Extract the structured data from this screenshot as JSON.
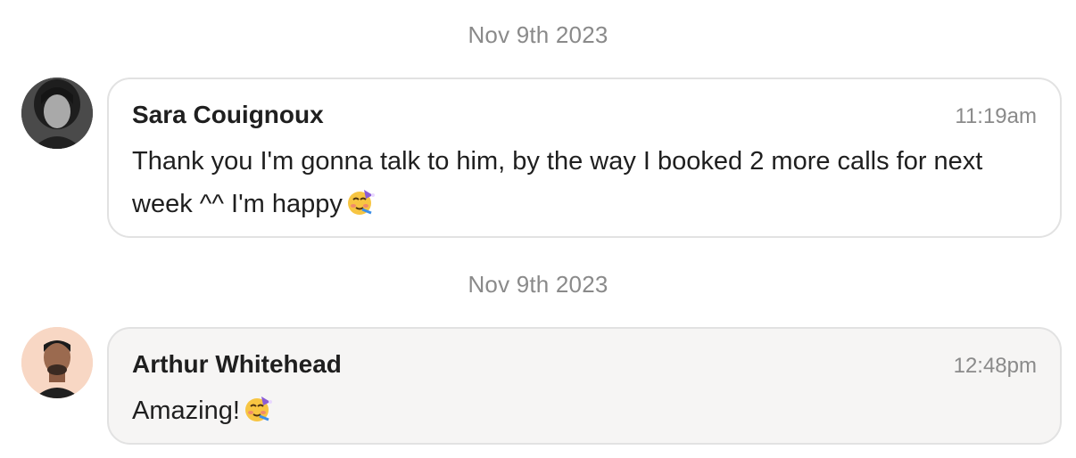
{
  "messages": [
    {
      "date": "Nov 9th 2023",
      "sender": "Sara Couignoux",
      "time": "11:19am",
      "text": "Thank you I'm gonna talk to him, by the way I booked 2 more calls for next week ^^ I'm happy",
      "emoji": "partying-face-emoji"
    },
    {
      "date": "Nov 9th 2023",
      "sender": "Arthur Whitehead",
      "time": "12:48pm",
      "text": "Amazing!",
      "emoji": "partying-face-emoji"
    }
  ],
  "colors": {
    "bubble_border": "#e2e2e2",
    "bubble_alt_bg": "#f6f5f4",
    "muted_text": "#8a8a8a",
    "text": "#1f1f1f"
  }
}
